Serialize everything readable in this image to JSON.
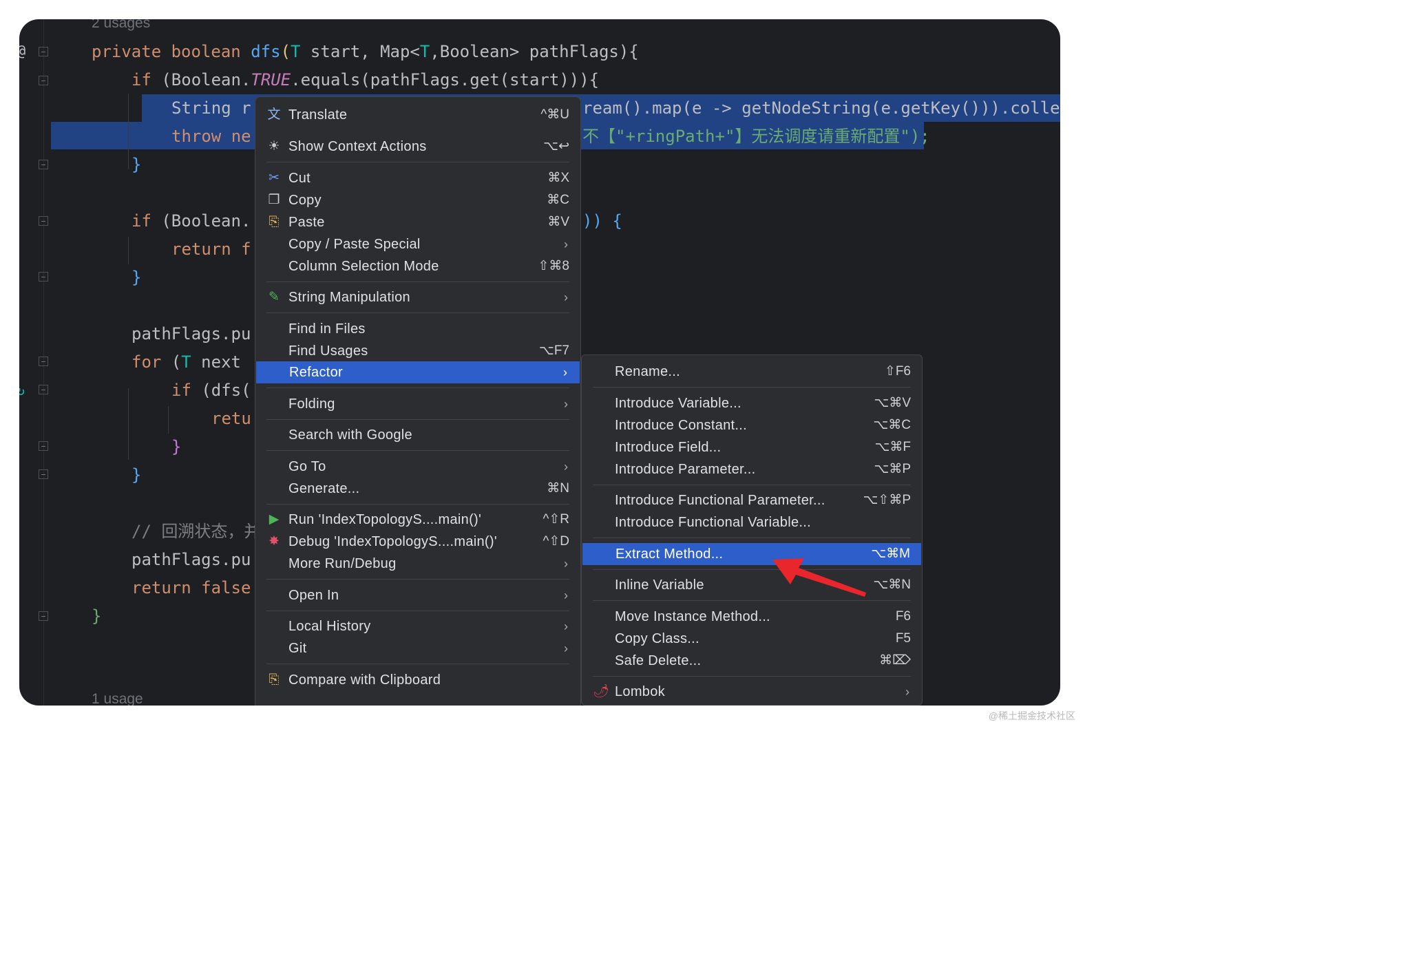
{
  "editor": {
    "usages_top": "2 usages",
    "usages_bottom": "1 usage",
    "lines": {
      "l1_kw": "private boolean",
      "l1_fn": "dfs",
      "l1_rest_a": "(",
      "l1_T1": "T",
      "l1_rest_b": " start, Map<",
      "l1_T2": "T",
      "l1_rest_c": ",Boolean> pathFlags){",
      "l2_if": "if",
      "l2_a": " (Boolean.",
      "l2_true": "TRUE",
      "l2_b": ".equals(pathFlags.get(start))){",
      "l3_a": "String r",
      "l3_b": "ream().map(e -> getNodeString(e.getKey())).colle",
      "l4_throw": "throw ne",
      "l4_b": "不【\"+ringPath+\"】无法调度请重新配置\");",
      "l5": "}",
      "l7_if": "if",
      "l7_a": " (Boolean.",
      "l7_b": ")) {",
      "l8_return": "return f",
      "l9": "}",
      "l11": "pathFlags.pu",
      "l12_for": "for",
      "l12_a": " (",
      "l12_T": "T",
      "l12_b": " next",
      "l13_if": "if",
      "l13_a": " (dfs(",
      "l14_ret": "retu",
      "l15": "}",
      "l16": "}",
      "l18": "// 回溯状态，并",
      "l19": "pathFlags.pu",
      "l20_return": "return false",
      "l21": "}"
    }
  },
  "context_menu": {
    "items": [
      {
        "label": "Translate",
        "shortcut": "^⌘U",
        "icon": "文"
      },
      {
        "label": "Show Context Actions",
        "shortcut": "⌥↩",
        "icon": "☀"
      },
      {
        "label": "Cut",
        "shortcut": "⌘X",
        "icon": "✂"
      },
      {
        "label": "Copy",
        "shortcut": "⌘C",
        "icon": "❐"
      },
      {
        "label": "Paste",
        "shortcut": "⌘V",
        "icon": "⎘"
      },
      {
        "label": "Copy / Paste Special",
        "arrow": "›"
      },
      {
        "label": "Column Selection Mode",
        "shortcut": "⇧⌘8"
      },
      {
        "label": "String Manipulation",
        "arrow": "›",
        "icon": "✎"
      },
      {
        "label": "Find in Files"
      },
      {
        "label": "Find Usages",
        "shortcut": "⌥F7"
      },
      {
        "label": "Refactor",
        "arrow": "›"
      },
      {
        "label": "Folding",
        "arrow": "›"
      },
      {
        "label": "Search with Google"
      },
      {
        "label": "Go To",
        "arrow": "›"
      },
      {
        "label": "Generate...",
        "shortcut": "⌘N"
      },
      {
        "label": "Run 'IndexTopologyS....main()'",
        "shortcut": "^⇧R",
        "icon": "▶"
      },
      {
        "label": "Debug 'IndexTopologyS....main()'",
        "shortcut": "^⇧D",
        "icon": "✸"
      },
      {
        "label": "More Run/Debug",
        "arrow": "›"
      },
      {
        "label": "Open In",
        "arrow": "›"
      },
      {
        "label": "Local History",
        "arrow": "›"
      },
      {
        "label": "Git",
        "arrow": "›"
      },
      {
        "label": "Compare with Clipboard",
        "icon": "⎘"
      }
    ]
  },
  "refactor_submenu": {
    "items": [
      {
        "label": "Rename...",
        "shortcut": "⇧F6"
      },
      {
        "label": "Introduce Variable...",
        "shortcut": "⌥⌘V"
      },
      {
        "label": "Introduce Constant...",
        "shortcut": "⌥⌘C"
      },
      {
        "label": "Introduce Field...",
        "shortcut": "⌥⌘F"
      },
      {
        "label": "Introduce Parameter...",
        "shortcut": "⌥⌘P"
      },
      {
        "label": "Introduce Functional Parameter...",
        "shortcut": "⌥⇧⌘P"
      },
      {
        "label": "Introduce Functional Variable..."
      },
      {
        "label": "Extract Method...",
        "shortcut": "⌥⌘M"
      },
      {
        "label": "Inline Variable",
        "shortcut": "⌥⌘N"
      },
      {
        "label": "Move Instance Method...",
        "shortcut": "F6"
      },
      {
        "label": "Copy Class...",
        "shortcut": "F5"
      },
      {
        "label": "Safe Delete...",
        "shortcut": "⌘⌦"
      },
      {
        "label": "Lombok",
        "arrow": "›",
        "icon": "🌶"
      }
    ]
  },
  "watermark": "@稀土掘金技术社区",
  "colors": {
    "accent": "#2e5ec9",
    "selection": "#214283",
    "arrow": "#e8262b"
  }
}
